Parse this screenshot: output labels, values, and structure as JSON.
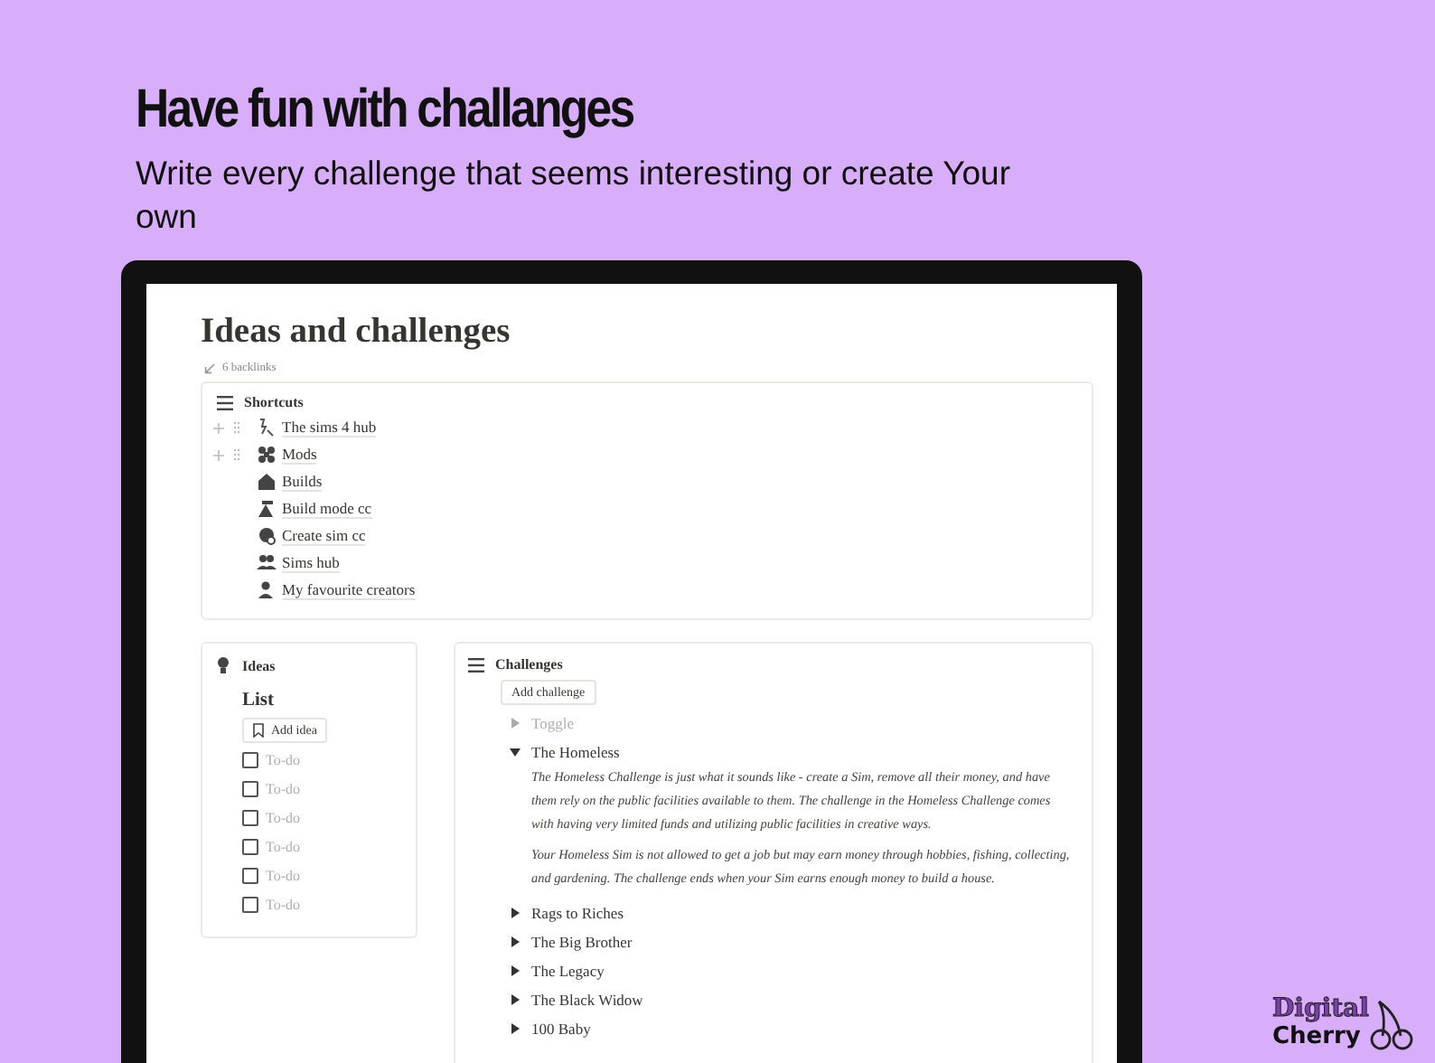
{
  "promo": {
    "title": "Have fun with challanges",
    "subtitle": "Write every challenge that seems interesting or create Your own"
  },
  "page": {
    "title": "Ideas and challenges",
    "backlinks": "6 backlinks"
  },
  "shortcuts": {
    "title": "Shortcuts",
    "items": [
      {
        "label": "The sims 4 hub",
        "hovered": true
      },
      {
        "label": "Mods",
        "hovered": true
      },
      {
        "label": "Builds",
        "hovered": false
      },
      {
        "label": "Build mode cc",
        "hovered": false
      },
      {
        "label": "Create sim cc",
        "hovered": false
      },
      {
        "label": "Sims hub",
        "hovered": false
      },
      {
        "label": "My favourite creators",
        "hovered": false
      }
    ]
  },
  "ideas": {
    "title": "Ideas",
    "list_title": "List",
    "add_button": "Add idea",
    "todos": [
      {
        "label": "To-do",
        "checked": false,
        "empty": true
      },
      {
        "label": "To-do",
        "checked": false,
        "empty": true
      },
      {
        "label": "To-do",
        "checked": false,
        "empty": true
      },
      {
        "label": "To-do",
        "checked": false,
        "empty": true
      },
      {
        "label": "To-do",
        "checked": false,
        "empty": true
      },
      {
        "label": "To-do",
        "checked": false,
        "empty": true
      }
    ]
  },
  "challenges": {
    "title": "Challenges",
    "add_button": "Add challenge",
    "toggles": [
      {
        "label": "Toggle",
        "empty": true,
        "expanded": false
      },
      {
        "label": "The Homeless",
        "empty": false,
        "expanded": true,
        "paragraphs": [
          "The Homeless Challenge is just what it sounds like - create a Sim, remove all their money, and have them rely on the public facilities available to them. The challenge in the Homeless Challenge comes with having very limited funds and utilizing public facilities in creative ways.",
          "Your Homeless Sim is not allowed to get a job but may earn money through hobbies, fishing, collecting, and gardening. The challenge ends when your Sim earns enough money to build a house."
        ]
      },
      {
        "label": "Rags to Riches",
        "empty": false,
        "expanded": false
      },
      {
        "label": "The Big Brother",
        "empty": false,
        "expanded": false
      },
      {
        "label": "The Legacy",
        "empty": false,
        "expanded": false
      },
      {
        "label": "The Black Widow",
        "empty": false,
        "expanded": false
      },
      {
        "label": "100 Baby",
        "empty": false,
        "expanded": false
      }
    ]
  },
  "logo": {
    "line_1": "Digital",
    "line_2": "Cherry"
  }
}
